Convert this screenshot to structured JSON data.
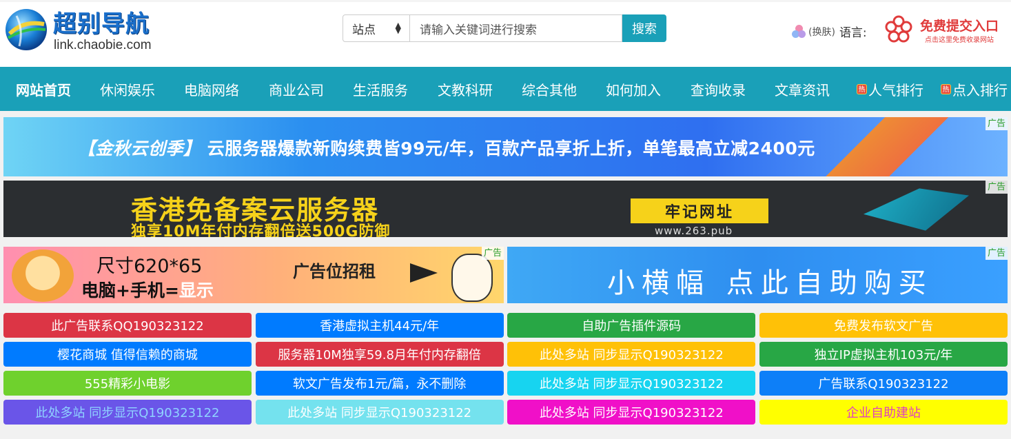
{
  "header": {
    "logo_title": "超别导航",
    "logo_domain": "link.chaobie.com",
    "search": {
      "select_value": "站点",
      "placeholder": "请输入关键词进行搜索",
      "button_label": "搜索"
    },
    "skin_label": "(换肤)",
    "language_label": "语言:",
    "submit_entry": {
      "title": "免费提交入口",
      "subtitle": "点击这里免费收录网站"
    }
  },
  "nav": {
    "items": [
      {
        "label": "网站首页",
        "hot": false
      },
      {
        "label": "休闲娱乐",
        "hot": false
      },
      {
        "label": "电脑网络",
        "hot": false
      },
      {
        "label": "商业公司",
        "hot": false
      },
      {
        "label": "生活服务",
        "hot": false
      },
      {
        "label": "文教科研",
        "hot": false
      },
      {
        "label": "综合其他",
        "hot": false
      },
      {
        "label": "如何加入",
        "hot": false
      },
      {
        "label": "查询收录",
        "hot": false
      },
      {
        "label": "文章资讯",
        "hot": false
      },
      {
        "label": "人气排行",
        "hot": true
      },
      {
        "label": "点入排行",
        "hot": true
      }
    ],
    "hot_badge": "热"
  },
  "banners": {
    "ad_tag": "广告",
    "b1": {
      "bracket_text": "【金秋云创季】",
      "text": "云服务器爆款新购续费皆99元/年，百款产品享折上折，单笔最高立减2400元"
    },
    "b2": {
      "title": "香港免备案云服务器",
      "subtitle": "独享10M年付内存翻倍送500G防御",
      "button": "牢记网址",
      "url": "www.263.pub"
    },
    "b3": {
      "line1": "尺寸620*65",
      "line2_a": "电脑+手机=",
      "line2_b": "显示",
      "slot": "广告位招租"
    },
    "b4": {
      "text": "小横幅 点此自助购买"
    }
  },
  "links": [
    {
      "label": "此广告联系QQ190323122",
      "bg": "#dc3545",
      "fg": "#ffffff"
    },
    {
      "label": "香港虚拟主机44元/年",
      "bg": "#007bff",
      "fg": "#ffffff"
    },
    {
      "label": "自助广告插件源码",
      "bg": "#28a745",
      "fg": "#ffffff"
    },
    {
      "label": "免费发布软文广告",
      "bg": "#ffc107",
      "fg": "#ffffff"
    },
    {
      "label": "樱花商城 值得信赖的商城",
      "bg": "#007bff",
      "fg": "#ffffff"
    },
    {
      "label": "服务器10M独享59.8月年付内存翻倍",
      "bg": "#dc3545",
      "fg": "#ffffff"
    },
    {
      "label": "此处多站 同步显示Q190323122",
      "bg": "#ffc107",
      "fg": "#ffffff"
    },
    {
      "label": "独立IP虚拟主机103元/年",
      "bg": "#28a745",
      "fg": "#ffffff"
    },
    {
      "label": "555精彩小电影",
      "bg": "#6fd12d",
      "fg": "#ffffff"
    },
    {
      "label": "软文广告发布1元/篇，永不删除",
      "bg": "#007bff",
      "fg": "#ffffff"
    },
    {
      "label": "此处多站 同步显示Q190323122",
      "bg": "#17d4f0",
      "fg": "#ffffff"
    },
    {
      "label": "广告联系Q190323122",
      "bg": "#0d7ff8",
      "fg": "#ffffff"
    },
    {
      "label": "此处多站 同步显示Q190323122",
      "bg": "#6a55e8",
      "fg": "#8fd3ff"
    },
    {
      "label": "此处多站 同步显示Q190323122",
      "bg": "#74e2ee",
      "fg": "#ffffff"
    },
    {
      "label": "此处多站 同步显示Q190323122",
      "bg": "#f010c8",
      "fg": "#ffffff"
    },
    {
      "label": "企业自助建站",
      "bg": "#ffff00",
      "fg": "#e040c0"
    }
  ],
  "colors": {
    "accent": "#1aa0b8"
  }
}
